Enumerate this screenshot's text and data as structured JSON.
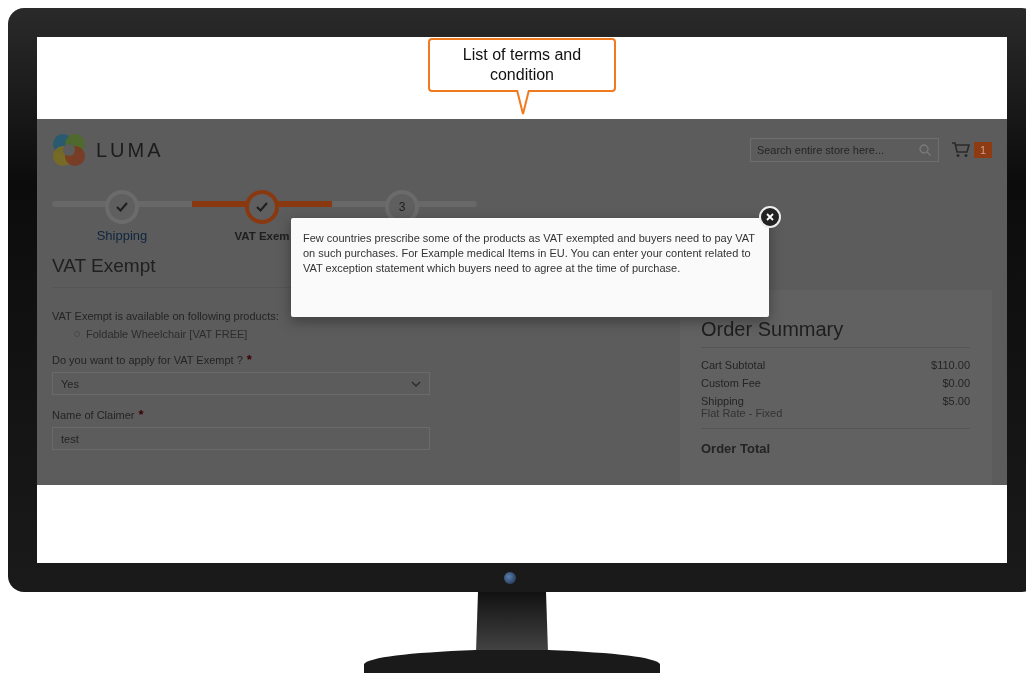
{
  "callout": {
    "text": "List of terms and condition"
  },
  "header": {
    "logo_text": "LUMA",
    "search": {
      "placeholder": "Search entire store here..."
    },
    "cart_count": "1"
  },
  "steps": [
    {
      "done": true,
      "selected": false,
      "label": "Shipping"
    },
    {
      "done": true,
      "selected": true,
      "label": "VAT Exem"
    },
    {
      "done": false,
      "selected": false,
      "number": "3"
    }
  ],
  "form": {
    "title": "VAT Exempt",
    "intro": "VAT Exempt is available on following products:",
    "products": [
      "Foldable Wheelchair [VAT FREE]"
    ],
    "fields": [
      {
        "kind": "select",
        "label": "Do you want to apply for VAT Exempt ?",
        "required_mark": "*",
        "value": "Yes"
      },
      {
        "kind": "text",
        "label": "Name of Claimer",
        "required_mark": "*",
        "value": "test"
      }
    ]
  },
  "summary": {
    "title": "Order Summary",
    "rows": [
      {
        "label": "Cart Subtotal",
        "value": "$110.00"
      },
      {
        "label": "Custom Fee",
        "value": "$0.00"
      },
      {
        "label": "Shipping",
        "sublabel": "Flat Rate - Fixed",
        "value": "$5.00"
      }
    ],
    "total_label": "Order Total"
  },
  "modal": {
    "text": "Few countries prescribe some of the products as VAT exempted and buyers need to pay VAT on such purchases. For Example medical Items in EU. You can enter your content related to VAT exception statement which buyers need to agree at the time of purchase."
  }
}
